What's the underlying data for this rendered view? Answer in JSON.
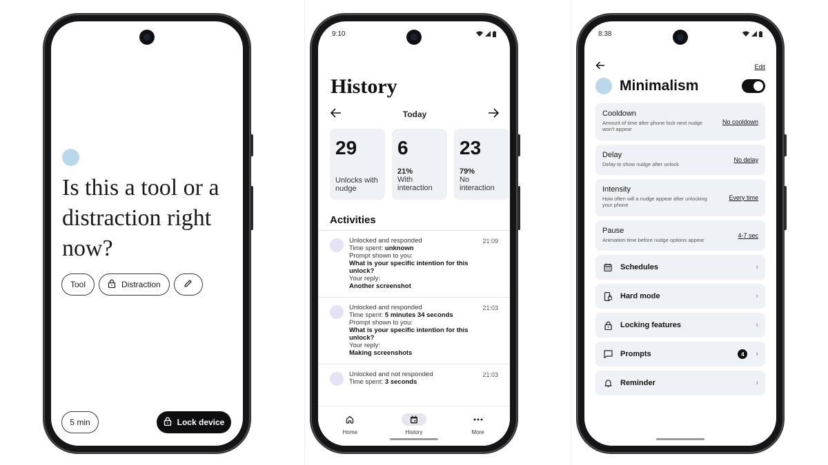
{
  "phone1": {
    "question": "Is this a tool or a distraction right now?",
    "chips": {
      "tool": "Tool",
      "distraction": "Distraction"
    },
    "duration": "5 min",
    "lock_button": "Lock device"
  },
  "phone2": {
    "status_time": "9:10",
    "title": "History",
    "date_label": "Today",
    "stats": [
      {
        "value": "29",
        "pct": "",
        "label": "Unlocks with nudge"
      },
      {
        "value": "6",
        "pct": "21%",
        "label": "With interaction"
      },
      {
        "value": "23",
        "pct": "79%",
        "label": "No interaction"
      }
    ],
    "activities_title": "Activities",
    "activities": [
      {
        "status": "Unlocked and responded",
        "time_label": "Time spent: ",
        "time_value": "unknown",
        "prompt_label": "Prompt shown to you:",
        "prompt": "What is your specific intention for this unlock?",
        "reply_label": "Your reply:",
        "reply": "Another screenshot",
        "clock": "21:09"
      },
      {
        "status": "Unlocked and responded",
        "time_label": "Time spent: ",
        "time_value": "5 minutes 34 seconds",
        "prompt_label": "Prompt shown to you:",
        "prompt": "What is your specific intention for this unlock?",
        "reply_label": "Your reply:",
        "reply": "Making screenshots",
        "clock": "21:03"
      },
      {
        "status": "Unlocked and not responded",
        "time_label": "Time spent: ",
        "time_value": "3 seconds",
        "clock": "21:03"
      }
    ],
    "nav": {
      "home": "Home",
      "history": "History",
      "more": "More"
    }
  },
  "phone3": {
    "status_time": "8:38",
    "edit": "Edit",
    "title": "Minimalism",
    "toggle_on": true,
    "settings": [
      {
        "name": "Cooldown",
        "sub": "Amount of time after phone lock next nudge won't appear",
        "value": "No cooldown"
      },
      {
        "name": "Delay",
        "sub": "Delay to show nudge after unlock",
        "value": "No delay"
      },
      {
        "name": "Intensity",
        "sub": "How often will a nudge appear after unlocking your phone",
        "value": "Every time"
      },
      {
        "name": "Pause",
        "sub": "Animation time before nudge options appear",
        "value": "4-7 sec"
      }
    ],
    "menu": [
      {
        "label": "Schedules",
        "icon": "calendar-icon"
      },
      {
        "label": "Hard mode",
        "icon": "phone-lock-icon"
      },
      {
        "label": "Locking features",
        "icon": "lock-icon"
      },
      {
        "label": "Prompts",
        "icon": "chat-icon",
        "badge": "4"
      },
      {
        "label": "Reminder",
        "icon": "bell-icon"
      }
    ]
  },
  "colors": {
    "accent_dot": "#b9d8ec",
    "card_bg": "#eef1f6",
    "avatar": "#e5e2f6",
    "dark": "#0e0e10"
  }
}
